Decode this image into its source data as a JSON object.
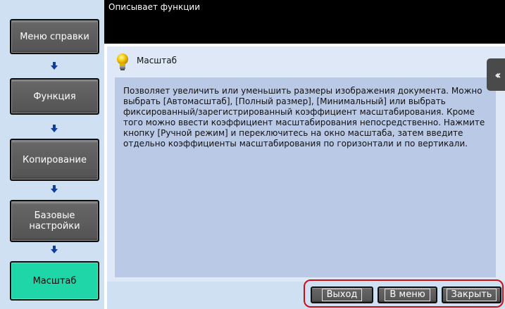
{
  "header": {
    "title": "Описывает функции"
  },
  "nav": {
    "items": [
      {
        "label": "Меню справки"
      },
      {
        "label": "Функция"
      },
      {
        "label": "Копирование"
      },
      {
        "label": "Базовые настройки"
      },
      {
        "label": "Масштаб"
      }
    ],
    "active_index": 4
  },
  "content": {
    "title": "Масштаб",
    "description": "Позволяет увеличить или уменьшить размеры изображения документа. Можно выбрать [Автомасштаб], [Полный размер], [Минимальный] или выбрать фиксированный/зарегистрированный коэффициент масштабирования. Кроме того можно ввести коэффициент масштабирования непосредственно. Нажмите кнопку [Ручной режим] и переключитесь на окно масштаба, затем введите отдельно коэффициенты масштабирования по горизонтали и по вертикали."
  },
  "footer": {
    "exit_label": "Выход",
    "menu_label": "В меню",
    "close_label": "Закрыть"
  },
  "icons": {
    "collapse": "double-chevron-left-icon",
    "title": "lightbulb-icon",
    "flow_arrow": "arrow-down-icon"
  },
  "colors": {
    "active_nav": "#1fd6a9",
    "header_bg": "#000000",
    "highlight": "#d20d12",
    "arrow": "#0d3e9e"
  }
}
